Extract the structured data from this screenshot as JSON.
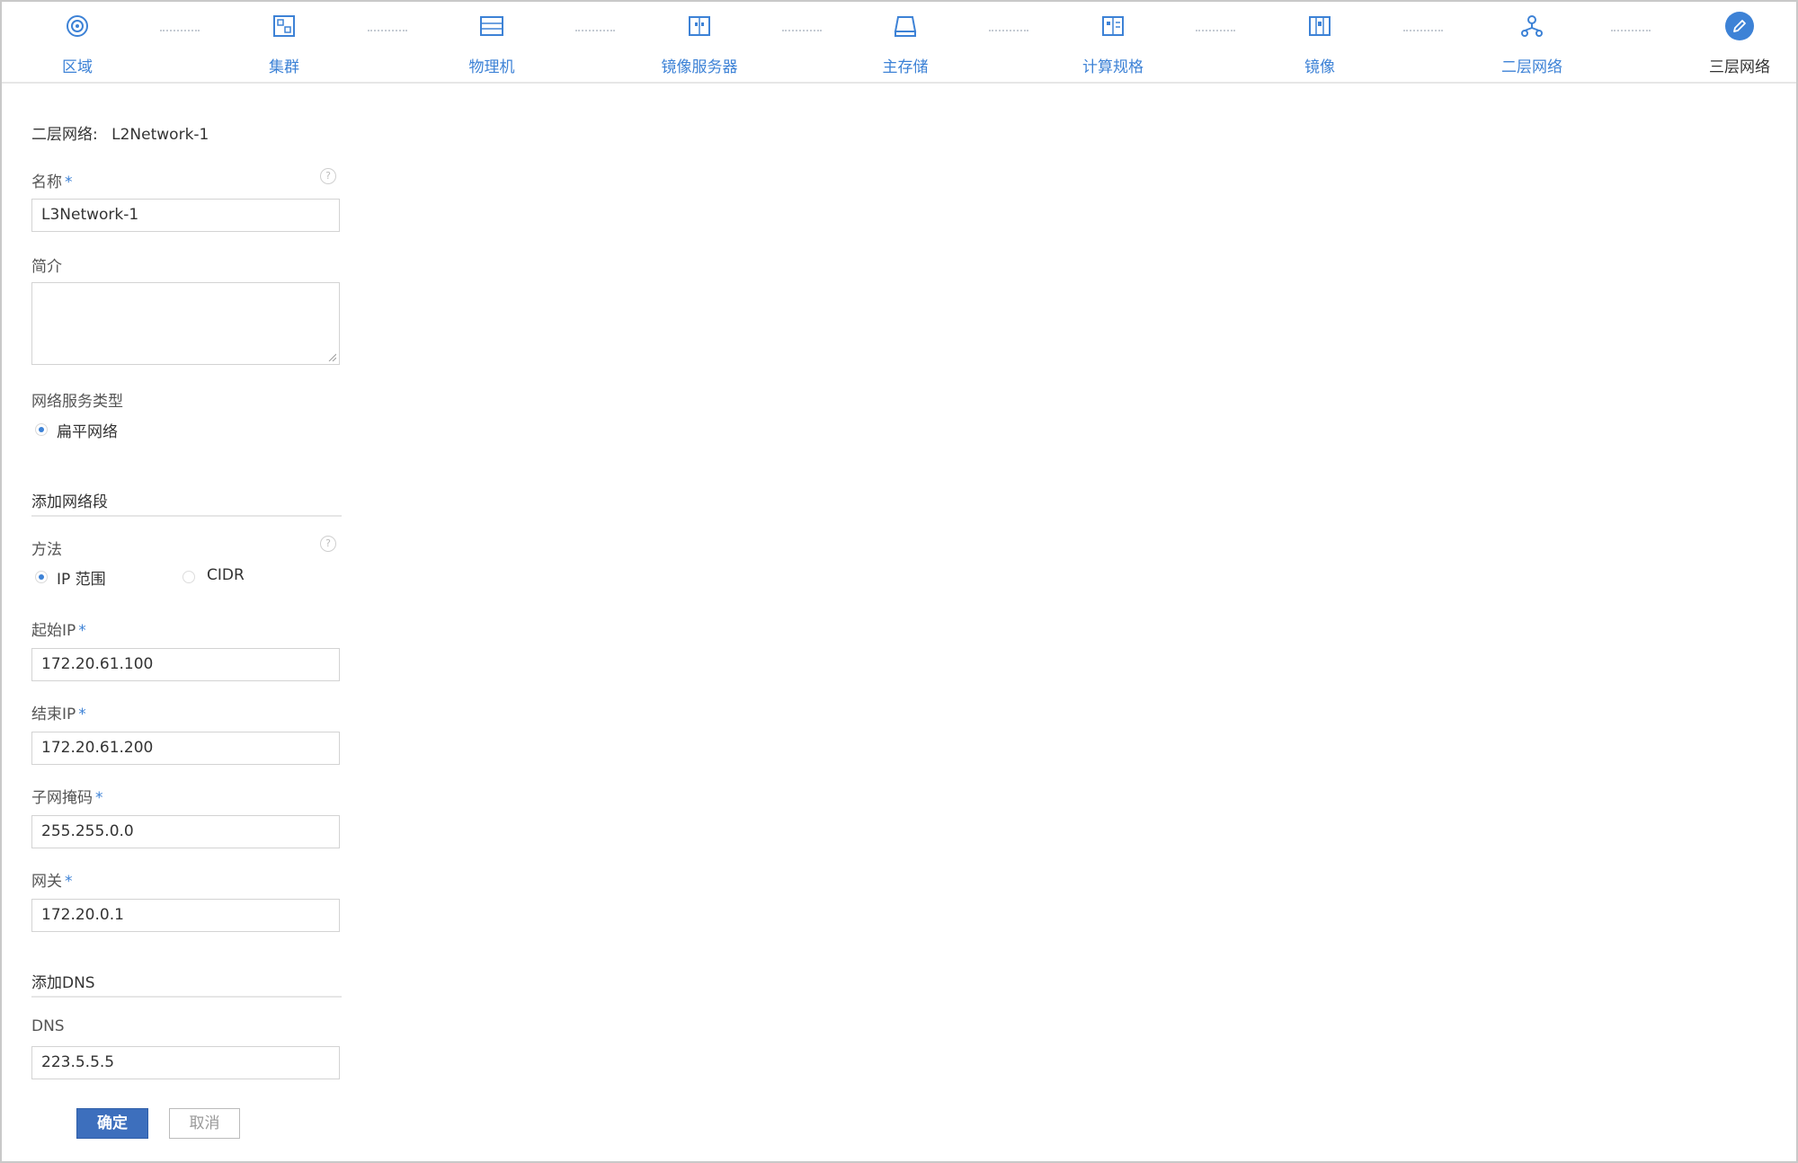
{
  "wizard": {
    "steps": [
      {
        "label": "区域",
        "icon": "region-icon"
      },
      {
        "label": "集群",
        "icon": "cluster-icon"
      },
      {
        "label": "物理机",
        "icon": "host-icon"
      },
      {
        "label": "镜像服务器",
        "icon": "backup-storage-icon"
      },
      {
        "label": "主存储",
        "icon": "primary-storage-icon"
      },
      {
        "label": "计算规格",
        "icon": "instance-offering-icon"
      },
      {
        "label": "镜像",
        "icon": "image-icon"
      },
      {
        "label": "二层网络",
        "icon": "l2-network-icon"
      },
      {
        "label": "三层网络",
        "icon": "pencil-icon"
      }
    ],
    "current_index": 8,
    "accent_color": "#3d82d6"
  },
  "form": {
    "l2_network_label": "二层网络:",
    "l2_network_value": "L2Network-1",
    "name": {
      "label": "名称",
      "required": "*",
      "value": "L3Network-1"
    },
    "description": {
      "label": "简介",
      "value": ""
    },
    "service_type": {
      "label": "网络服务类型",
      "options": [
        {
          "label": "扁平网络",
          "selected": true
        }
      ]
    },
    "add_range_section": "添加网络段",
    "method": {
      "label": "方法",
      "options": [
        {
          "label": "IP 范围",
          "selected": true
        },
        {
          "label": "CIDR",
          "selected": false
        }
      ]
    },
    "start_ip": {
      "label": "起始IP",
      "required": "*",
      "value": "172.20.61.100"
    },
    "end_ip": {
      "label": "结束IP",
      "required": "*",
      "value": "172.20.61.200"
    },
    "netmask": {
      "label": "子网掩码",
      "required": "*",
      "value": "255.255.0.0"
    },
    "gateway": {
      "label": "网关",
      "required": "*",
      "value": "172.20.0.1"
    },
    "add_dns_section": "添加DNS",
    "dns": {
      "label": "DNS",
      "value": "223.5.5.5"
    },
    "help_glyph": "?",
    "buttons": {
      "confirm": "确定",
      "cancel": "取消"
    }
  }
}
